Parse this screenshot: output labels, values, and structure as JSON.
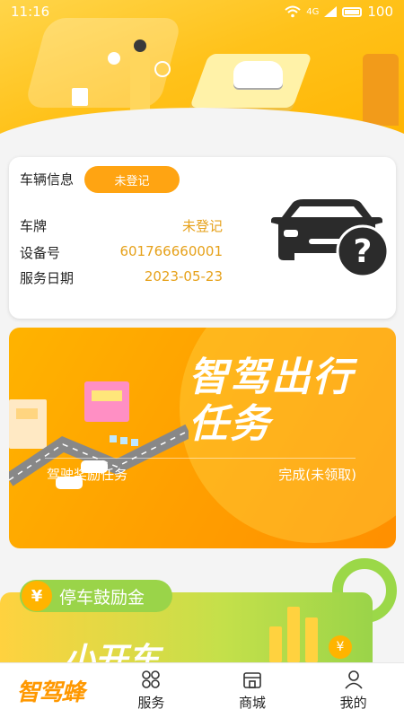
{
  "status_bar": {
    "time": "11:16",
    "network": "4G",
    "battery": "100"
  },
  "vehicle_card": {
    "title": "车辆信息",
    "badge": "未登记",
    "rows": [
      {
        "key": "车牌",
        "value": "未登记"
      },
      {
        "key": "设备号",
        "value": "601766660001"
      },
      {
        "key": "服务日期",
        "value": "2023-05-23"
      }
    ],
    "car_icon": "car-question-icon"
  },
  "task_banner": {
    "headline_line1": "智驾出行",
    "headline_line2": "任务",
    "label_left": "驾驶奖励任务",
    "label_right": "完成(未领取)"
  },
  "parking_card": {
    "pill_icon": "¥",
    "pill_label": "停车鼓励金",
    "big_text": "小开车",
    "coin_symbol": "¥"
  },
  "bottom_nav": {
    "logo": "智驾蜂",
    "items": [
      {
        "label": "服务",
        "icon": "grid-icon"
      },
      {
        "label": "商城",
        "icon": "store-icon"
      },
      {
        "label": "我的",
        "icon": "person-icon"
      }
    ]
  },
  "colors": {
    "accent": "#ffa412",
    "value_text": "#e6a11a",
    "green": "#9ad449"
  }
}
